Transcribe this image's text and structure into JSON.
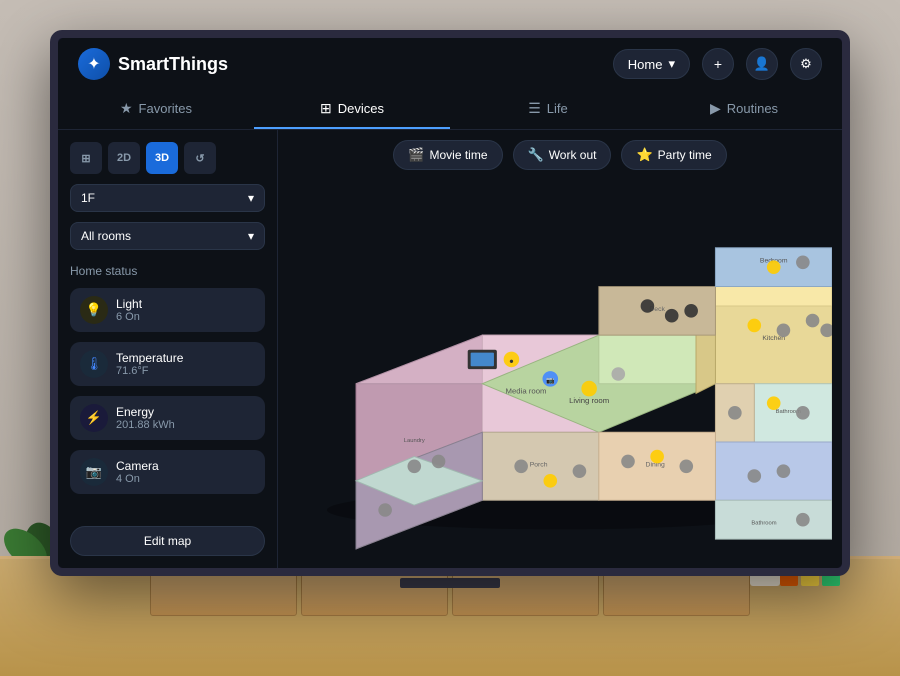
{
  "app": {
    "name": "SmartThings",
    "logo_symbol": "✦"
  },
  "header": {
    "home_label": "Home",
    "add_btn": "+",
    "profile_btn": "👤",
    "settings_btn": "⚙"
  },
  "nav": {
    "tabs": [
      {
        "id": "favorites",
        "label": "Favorites",
        "icon": "★",
        "active": false
      },
      {
        "id": "devices",
        "label": "Devices",
        "icon": "⊞",
        "active": true
      },
      {
        "id": "life",
        "label": "Life",
        "icon": "☰",
        "active": false
      },
      {
        "id": "routines",
        "label": "Routines",
        "icon": "▶",
        "active": false
      }
    ]
  },
  "sidebar": {
    "view_buttons": [
      {
        "id": "grid",
        "label": "⊞",
        "active": false
      },
      {
        "id": "2d",
        "label": "2D",
        "active": false
      },
      {
        "id": "3d",
        "label": "3D",
        "active": true
      },
      {
        "id": "history",
        "label": "↺",
        "active": false
      }
    ],
    "floor": {
      "label": "1F",
      "dropdown_icon": "▾"
    },
    "room": {
      "label": "All rooms",
      "dropdown_icon": "▾"
    },
    "home_status": {
      "section_label": "Home status",
      "items": [
        {
          "id": "light",
          "name": "Light",
          "value": "6 On",
          "icon": "💡",
          "type": "light"
        },
        {
          "id": "temperature",
          "name": "Temperature",
          "value": "71.6°F",
          "icon": "🌡",
          "type": "temp"
        },
        {
          "id": "energy",
          "name": "Energy",
          "value": "201.88 kWh",
          "icon": "⚡",
          "type": "energy"
        },
        {
          "id": "camera",
          "name": "Camera",
          "value": "4 On",
          "icon": "📷",
          "type": "camera"
        }
      ]
    },
    "edit_map_label": "Edit map"
  },
  "scenes": [
    {
      "id": "movie_time",
      "label": "Movie time",
      "icon": "🎬"
    },
    {
      "id": "work_out",
      "label": "Work out",
      "icon": "🔧"
    },
    {
      "id": "party_time",
      "label": "Party time",
      "icon": "⭐"
    }
  ],
  "colors": {
    "accent": "#1a6bdb",
    "bg_dark": "#0d1117",
    "bg_card": "#1e2535",
    "text_primary": "#ffffff",
    "text_secondary": "#8899aa",
    "active_tab": "#4d9fff"
  }
}
